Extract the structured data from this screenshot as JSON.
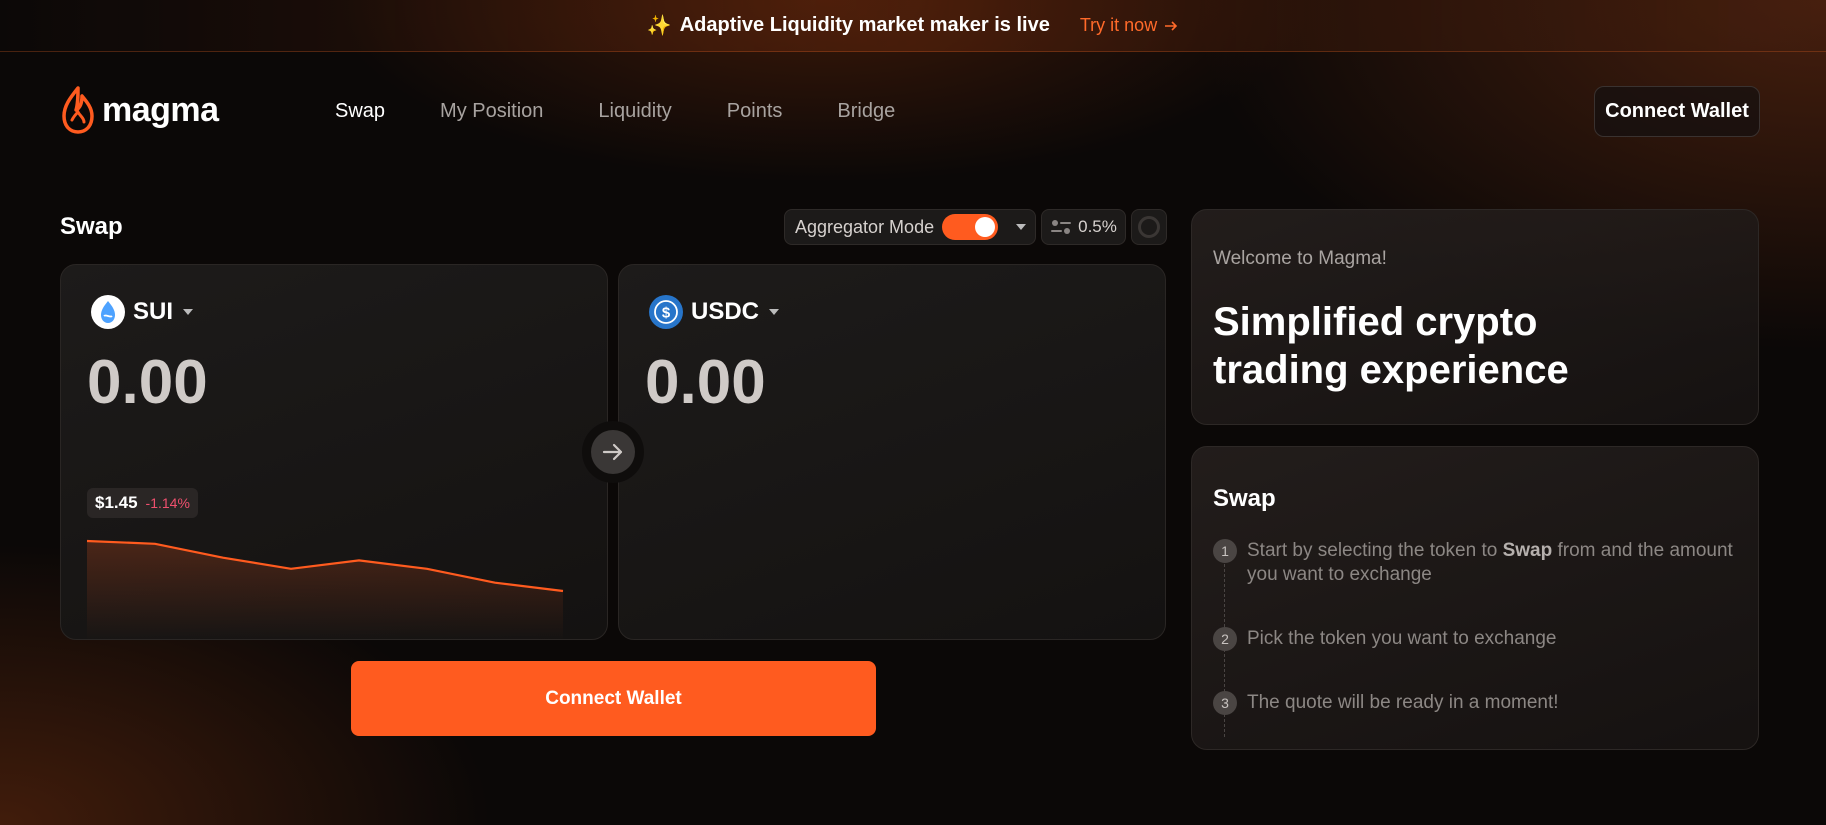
{
  "banner": {
    "text": "Adaptive Liquidity market maker is live",
    "link": "Try it now"
  },
  "header": {
    "logo": "magma",
    "nav": [
      "Swap",
      "My Position",
      "Liquidity",
      "Points",
      "Bridge"
    ],
    "active_nav": "Swap",
    "connect_wallet": "Connect Wallet"
  },
  "swap": {
    "title": "Swap",
    "aggregator_label": "Aggregator Mode",
    "aggregator_on": true,
    "slippage": "0.5%",
    "from": {
      "token": "SUI",
      "amount": "0.00",
      "price": "$1.45",
      "change": "-1.14%",
      "sparkline": [
        1.52,
        1.515,
        1.49,
        1.47,
        1.485,
        1.47,
        1.445,
        1.43
      ]
    },
    "to": {
      "token": "USDC",
      "amount": "0.00"
    },
    "connect_button": "Connect Wallet"
  },
  "welcome": {
    "subtitle": "Welcome to Magma!",
    "title": "Simplified crypto trading experience"
  },
  "guide": {
    "title": "Swap",
    "steps": [
      {
        "num": "1",
        "pre": "Start by selecting the token to ",
        "bold": "Swap",
        "post": " from and the amount you want to exchange"
      },
      {
        "num": "2",
        "pre": "Pick the token you want to exchange",
        "bold": "",
        "post": ""
      },
      {
        "num": "3",
        "pre": "The quote will be ready in a moment!",
        "bold": "",
        "post": ""
      }
    ]
  },
  "colors": {
    "accent": "#ff5b1f",
    "negative": "#f0506e",
    "sui_blue": "#4da2ff",
    "usdc_blue": "#2775ca"
  }
}
